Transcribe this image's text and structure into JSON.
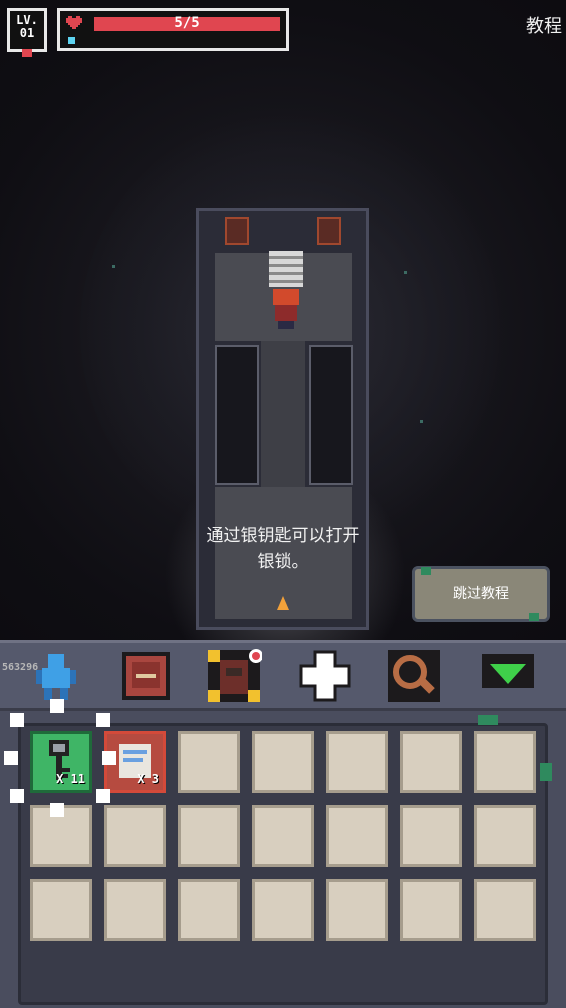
{
  "hud": {
    "level_label": "LV.",
    "level_value": "01",
    "hp_text": "5/5",
    "hp_fraction": 1.0,
    "menu_title": "教程"
  },
  "dialog": {
    "hint_line1": "通过银钥匙可以打开",
    "hint_line2": "银锁。",
    "skip_label": "跳过教程"
  },
  "inventory": {
    "fps_counter": "563296",
    "tabs": [
      "character-icon",
      "spellbook-icon",
      "backpack-icon",
      "plus-icon",
      "magnifier-icon",
      "collapse-arrow-icon"
    ],
    "items": [
      {
        "name": "silver-key-icon",
        "qty": "X 11"
      },
      {
        "name": "scroll-icon",
        "qty": "X 3"
      }
    ]
  },
  "colors": {
    "hp": "#e04650",
    "selected_slot": "#3fb566",
    "item2_border": "#d44a3a"
  }
}
